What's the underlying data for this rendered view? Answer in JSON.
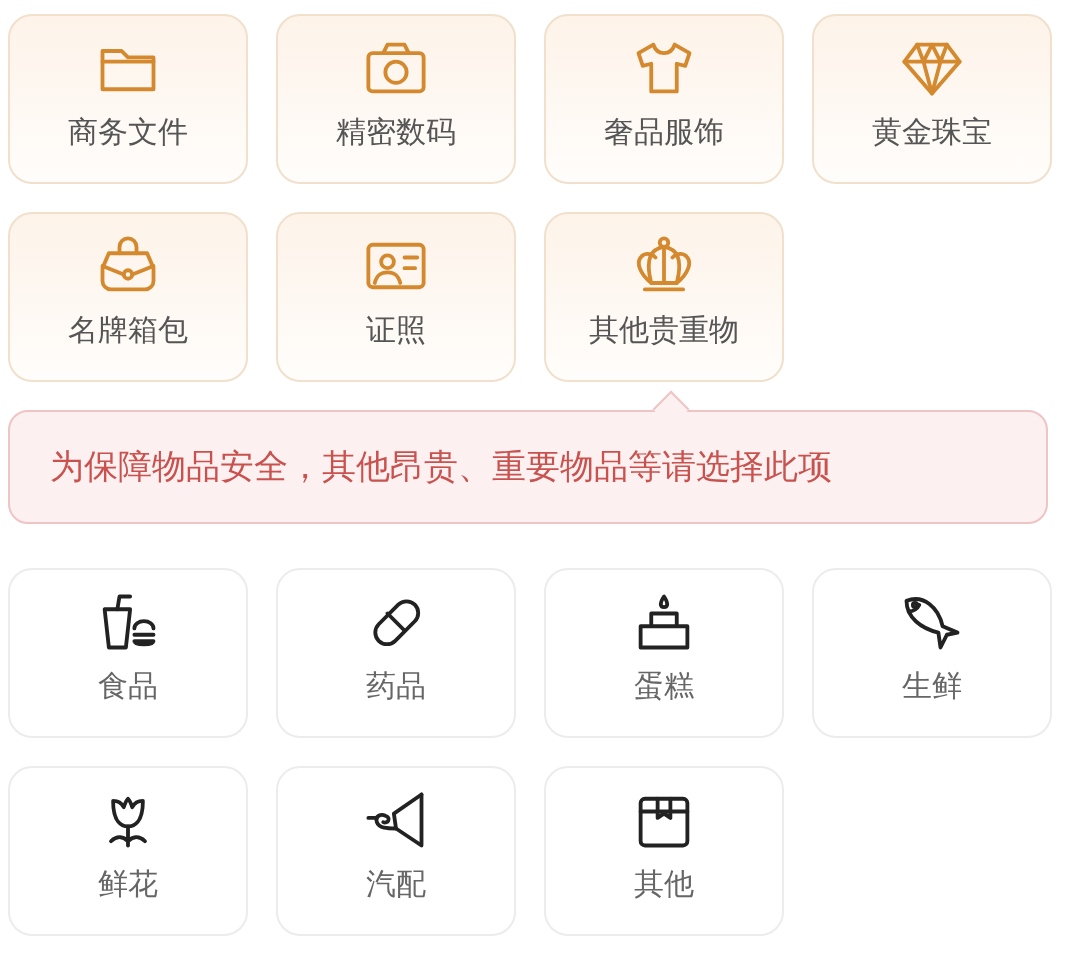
{
  "groups": [
    {
      "kind": "premium",
      "items": [
        {
          "label": "商务文件"
        },
        {
          "label": "精密数码"
        },
        {
          "label": "奢品服饰"
        },
        {
          "label": "黄金珠宝"
        },
        {
          "label": "名牌箱包"
        },
        {
          "label": "证照"
        },
        {
          "label": "其他贵重物"
        }
      ],
      "note": "为保障物品安全，其他昂贵、重要物品等请选择此项"
    },
    {
      "kind": "regular",
      "items": [
        {
          "label": "食品"
        },
        {
          "label": "药品"
        },
        {
          "label": "蛋糕"
        },
        {
          "label": "生鲜"
        },
        {
          "label": "鲜花"
        },
        {
          "label": "汽配"
        },
        {
          "label": "其他"
        }
      ]
    }
  ]
}
